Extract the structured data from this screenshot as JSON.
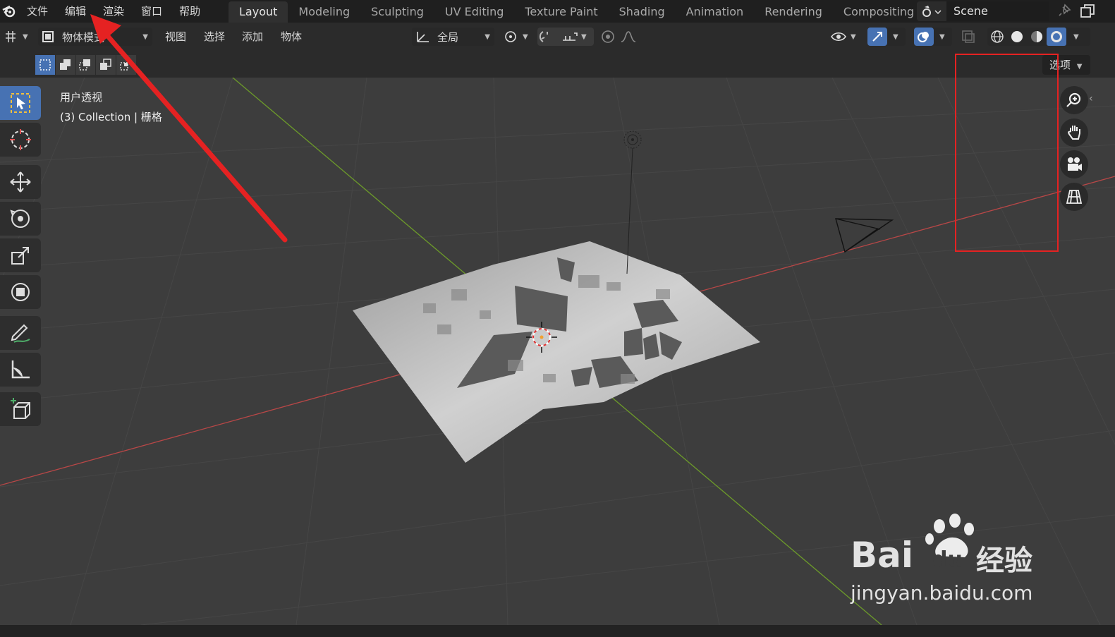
{
  "menu": {
    "items": [
      "文件",
      "编辑",
      "渲染",
      "窗口",
      "帮助"
    ]
  },
  "workspaces": {
    "tabs": [
      "Layout",
      "Modeling",
      "Sculpting",
      "UV Editing",
      "Texture Paint",
      "Shading",
      "Animation",
      "Rendering",
      "Compositing"
    ],
    "active": "Layout"
  },
  "scene": {
    "name": "Scene"
  },
  "header": {
    "mode": "物体模式",
    "menus": [
      "视图",
      "选择",
      "添加",
      "物体"
    ],
    "orientation": "全局"
  },
  "row3": {
    "options": "选项"
  },
  "viewport": {
    "view_name": "用户透视",
    "collection": "(3) Collection | 栅格"
  },
  "watermark": {
    "brand": "Bai",
    "brand_du": "du",
    "brand_cn": "经验",
    "url": "jingyan.baidu.com"
  },
  "colors": {
    "accent": "#4772b3",
    "annotation_red": "#e52222",
    "x_axis": "#b84747",
    "y_axis": "#6c9a2a"
  }
}
